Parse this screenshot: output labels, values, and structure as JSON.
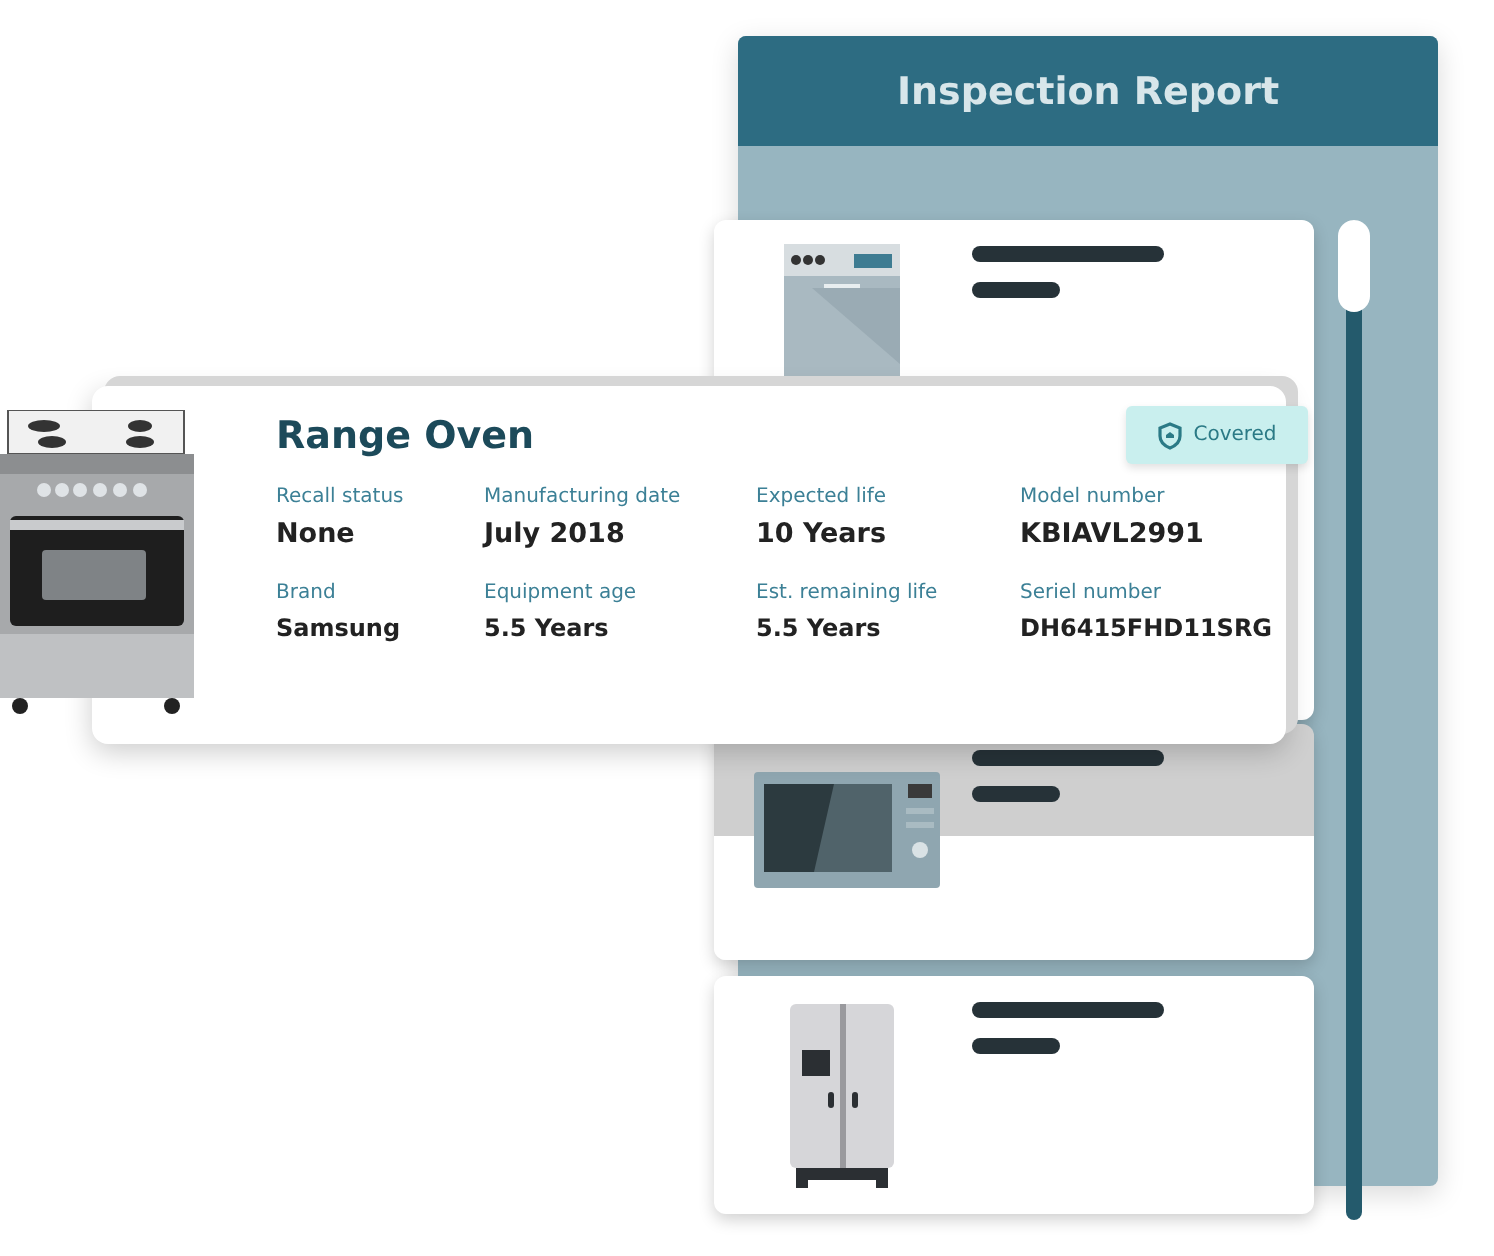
{
  "report": {
    "title": "Inspection Report"
  },
  "appliances": [
    {
      "kind": "dishwasher"
    },
    {
      "kind": "microwave"
    },
    {
      "kind": "fridge"
    }
  ],
  "detail": {
    "title": "Range Oven",
    "badge": "Covered",
    "fields": [
      {
        "label": "Recall status",
        "value": "None"
      },
      {
        "label": "Manufacturing date",
        "value": "July 2018"
      },
      {
        "label": "Expected life",
        "value": "10 Years"
      },
      {
        "label": "Model number",
        "value": "KBIAVL2991"
      },
      {
        "label": "Brand",
        "value": "Samsung"
      },
      {
        "label": "Equipment age",
        "value": "5.5 Years"
      },
      {
        "label": "Est. remaining life",
        "value": "5.5 Years"
      },
      {
        "label": "Seriel number",
        "value": "DH6415FHD11SRG"
      }
    ]
  }
}
